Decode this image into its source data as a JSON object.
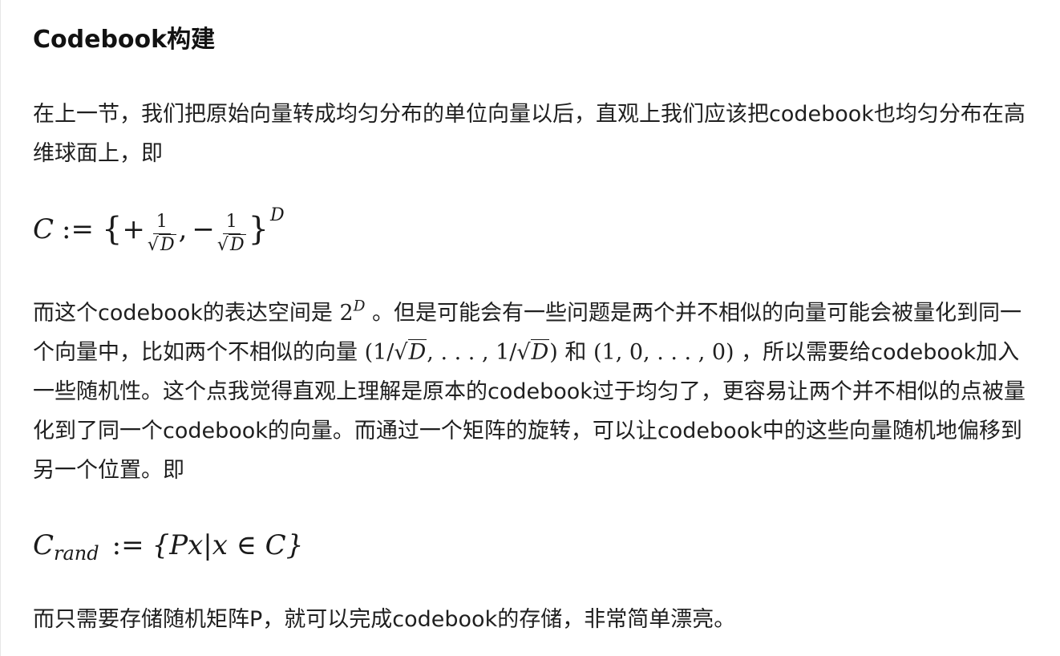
{
  "heading": "Codebook构建",
  "p1": {
    "text": "在上一节，我们把原始向量转成均匀分布的单位向量以后，直观上我们应该把codebook也均匀分布在高维球面上，即"
  },
  "formula1": {
    "lhs": "C",
    "assign": ":=",
    "open_brace": "{",
    "plus": "+",
    "num": "1",
    "den_sqrt": "√",
    "den_var": "D",
    "comma": ",",
    "minus": "−",
    "close_brace": "}",
    "power": "D"
  },
  "p2": {
    "a": "而这个codebook的表达空间是 ",
    "m1_base": "2",
    "m1_exp": "D",
    "b": " 。但是可能会有一些问题是两个并不相似的向量可能会被量化到同一个向量中，比如两个不相似的向量 ",
    "m2_open": "(1/",
    "m2_sqrt": "√",
    "m2_var": "D",
    "m2_mid": ", . . . , 1/",
    "m2_close": ")",
    "c": " 和 ",
    "m3": "(1, 0, . . . , 0)",
    "d": " ，所以需要给codebook加入一些随机性。这个点我觉得直观上理解是原本的codebook过于均匀了，更容易让两个并不相似的点被量化到了同一个codebook的向量。而通过一个矩阵的旋转，可以让codebook中的这些向量随机地偏移到另一个位置。即"
  },
  "formula2": {
    "lhs": "C",
    "sub": "rand",
    "assign": ":=",
    "body": "{Px|x ∈ C}"
  },
  "p3": {
    "text": "而只需要存储随机矩阵P，就可以完成codebook的存储，非常简单漂亮。"
  }
}
